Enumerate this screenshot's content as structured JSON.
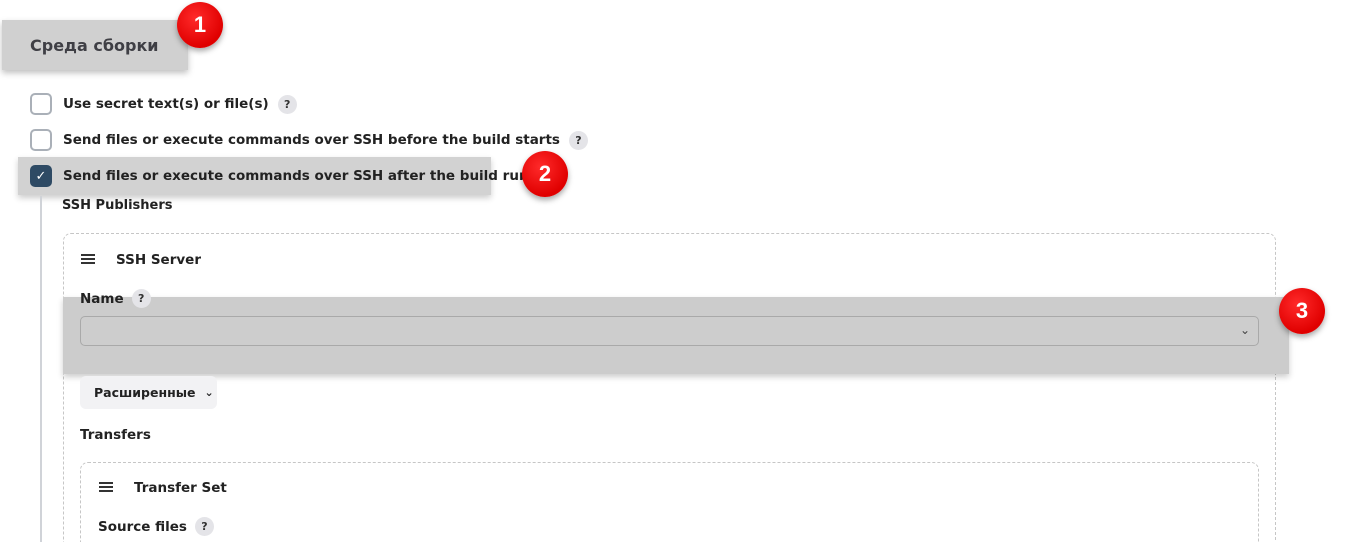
{
  "section": {
    "title": "Среда сборки"
  },
  "annotations": [
    "1",
    "2",
    "3"
  ],
  "options": [
    {
      "label": "Use secret text(s) or file(s)",
      "checked": false,
      "help": "?"
    },
    {
      "label": "Send files or execute commands over SSH before the build starts",
      "checked": false,
      "help": "?"
    },
    {
      "label": "Send files or execute commands over SSH after the build runs",
      "checked": true,
      "help": "?"
    }
  ],
  "check_glyph": "✓",
  "ssh": {
    "publishers_label": "SSH Publishers",
    "server": {
      "title": "SSH Server",
      "name_label": "Name",
      "name_help": "?",
      "name_value": "",
      "advanced_label": "Расширенные",
      "advanced_icon": "chevron-down-icon",
      "transfers_label": "Transfers",
      "transfer_set": {
        "title": "Transfer Set",
        "source_files_label": "Source files",
        "source_files_help": "?"
      }
    }
  },
  "colors": {
    "badge": "#e00000",
    "checkbox_checked": "#2e4a64",
    "highlight": "#d0d0d0"
  }
}
